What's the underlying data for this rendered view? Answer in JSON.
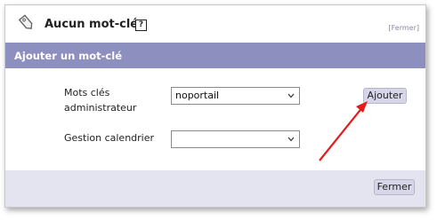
{
  "header": {
    "title": "Aucun mot-clé",
    "help_label": "?",
    "close_label": "[Fermer]"
  },
  "section": {
    "title": "Ajouter un mot-clé"
  },
  "form": {
    "admin_keywords_label": "Mots clés administrateur",
    "admin_keywords_value": "noportail",
    "calendar_label": "Gestion calendrier",
    "calendar_value": "",
    "add_button": "Ajouter"
  },
  "footer": {
    "close_button": "Fermer"
  },
  "colors": {
    "section_bar": "#8d8fbf",
    "footer": "#e4e4f0",
    "button": "#d6d6e8",
    "arrow": "#e31c1c"
  },
  "icons": {
    "tag": "tag-icon",
    "help": "help-icon",
    "dropdown": "chevron-down-icon"
  }
}
